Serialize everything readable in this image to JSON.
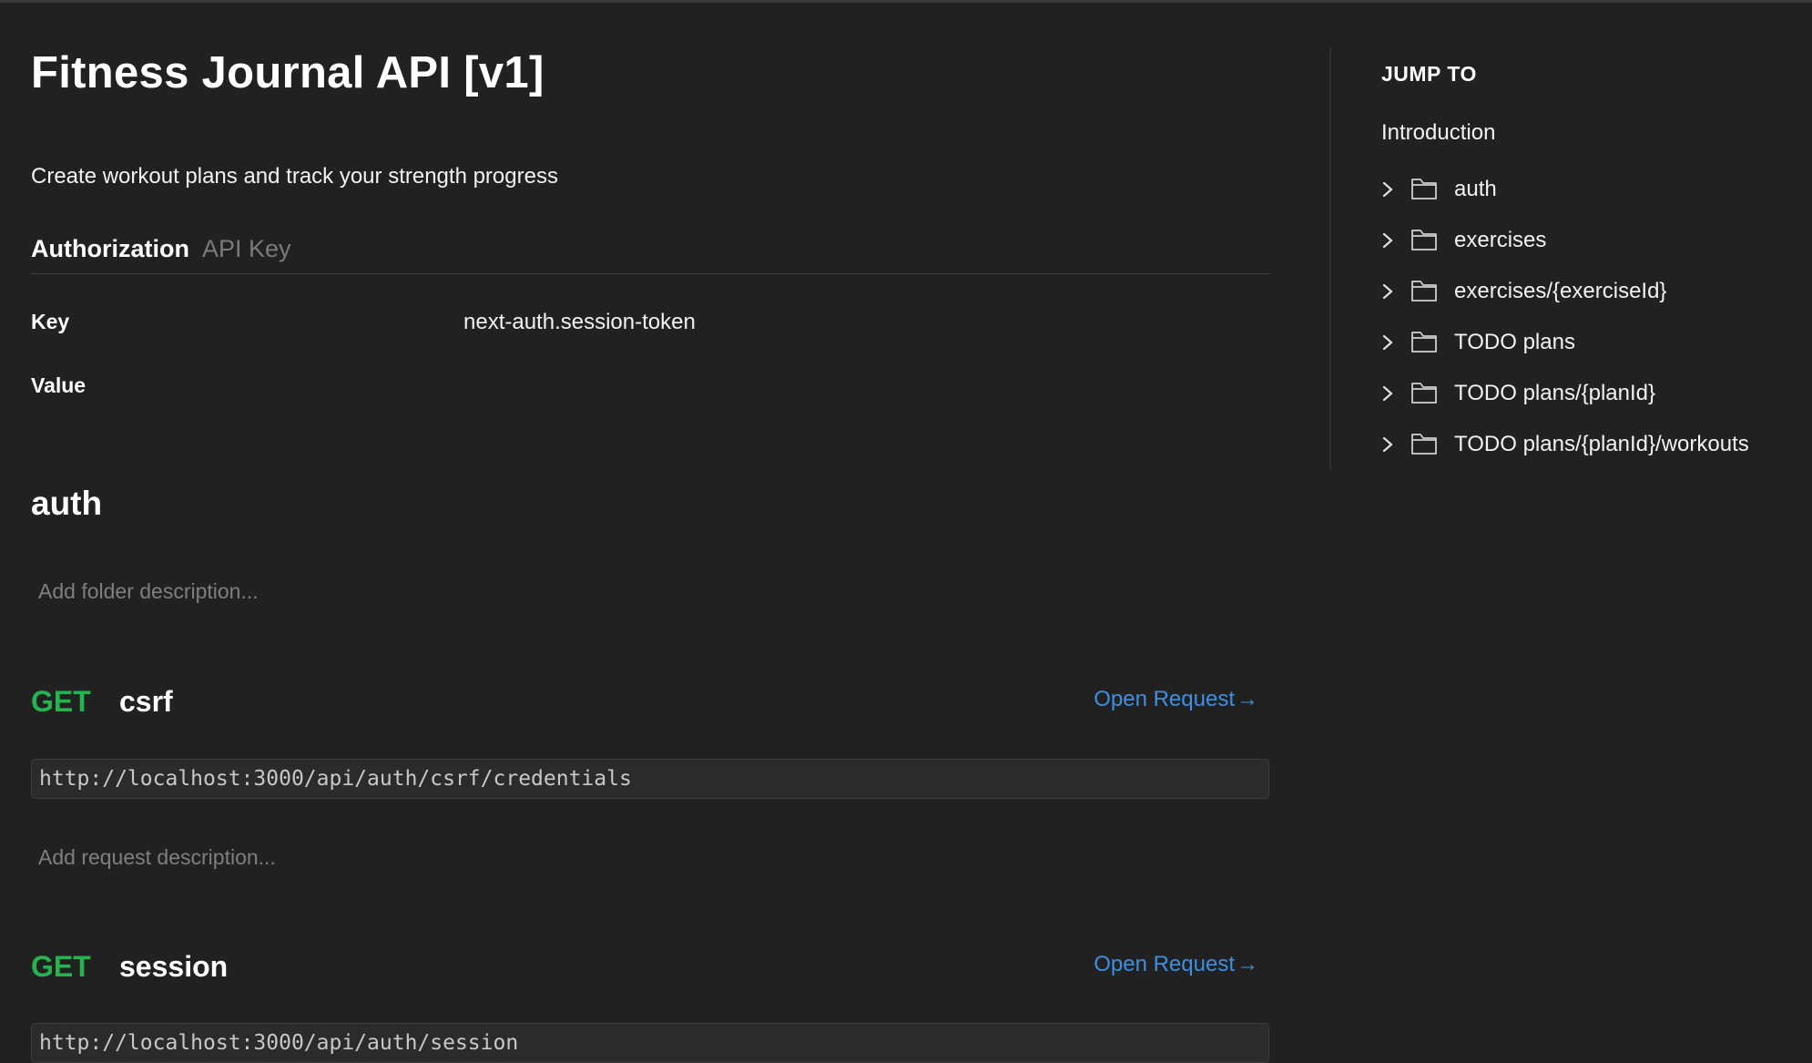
{
  "doc": {
    "title": "Fitness Journal API [v1]",
    "description": "Create workout plans and track your strength progress"
  },
  "authorization": {
    "label": "Authorization",
    "type": "API Key",
    "key_label": "Key",
    "key_value": "next-auth.session-token",
    "value_label": "Value",
    "value_value": ""
  },
  "folder": {
    "title": "auth",
    "description_placeholder": "Add folder description..."
  },
  "requests": [
    {
      "method": "GET",
      "name": "csrf",
      "open_label": "Open Request",
      "url": "http://localhost:3000/api/auth/csrf/credentials",
      "description_placeholder": "Add request description..."
    },
    {
      "method": "GET",
      "name": "session",
      "open_label": "Open Request",
      "url": "http://localhost:3000/api/auth/session"
    }
  ],
  "jump_to": {
    "title": "JUMP TO",
    "intro": "Introduction",
    "items": [
      {
        "label": "auth",
        "icon": "folder-icon"
      },
      {
        "label": "exercises",
        "icon": "folder-icon"
      },
      {
        "label": "exercises/{exerciseId}",
        "icon": "folder-icon"
      },
      {
        "label": "TODO plans",
        "icon": "folder-icon"
      },
      {
        "label": "TODO plans/{planId}",
        "icon": "folder-icon"
      },
      {
        "label": "TODO plans/{planId}/workouts",
        "icon": "folder-icon"
      }
    ]
  },
  "colors": {
    "background": "#212121",
    "method_get": "#26b24f",
    "link": "#3f8fe0",
    "muted": "#7f7f7f"
  }
}
